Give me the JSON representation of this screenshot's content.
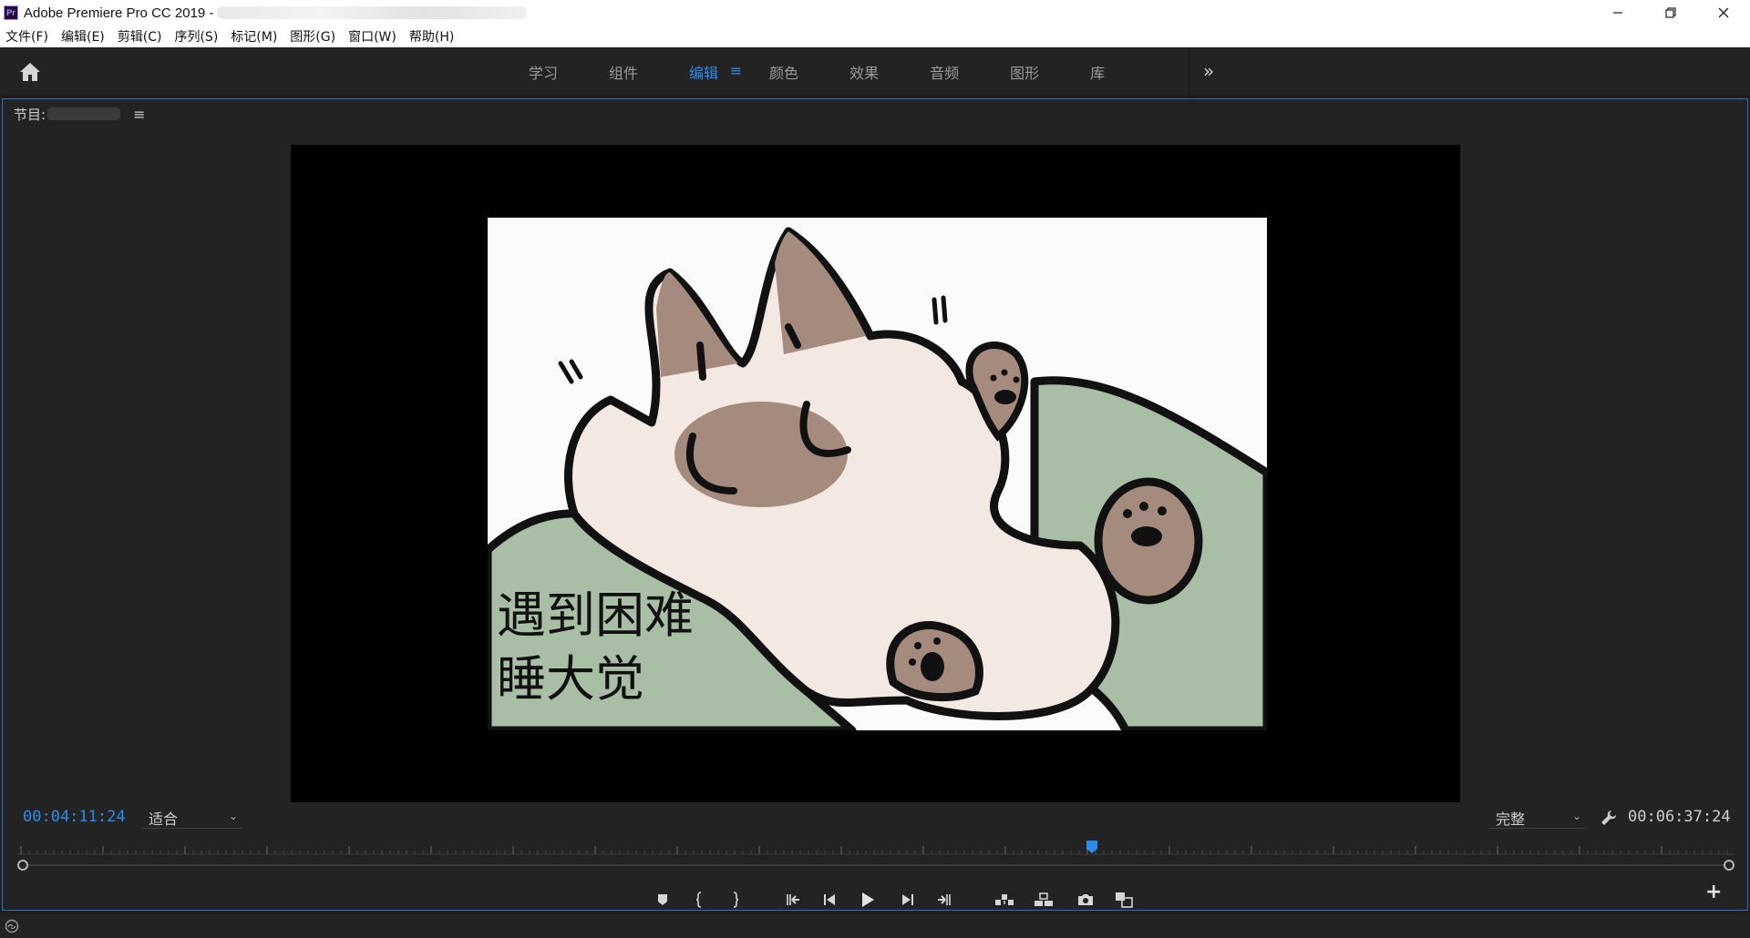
{
  "window": {
    "title": "Adobe Premiere Pro CC 2019 -",
    "app_logo": "Pr",
    "controls": [
      "minimize-icon",
      "restore-icon",
      "close-icon"
    ]
  },
  "menu": [
    "文件(F)",
    "编辑(E)",
    "剪辑(C)",
    "序列(S)",
    "标记(M)",
    "图形(G)",
    "窗口(W)",
    "帮助(H)"
  ],
  "workspaces": {
    "tabs": [
      "学习",
      "组件",
      "编辑",
      "颜色",
      "效果",
      "音频",
      "图形",
      "库"
    ],
    "active": "编辑",
    "overflow": "»"
  },
  "program_monitor": {
    "panel_label": "节目:",
    "frame_caption_line1": "遇到困难",
    "frame_caption_line2": "睡大觉",
    "timecode_current": "00:04:11:24",
    "zoom_select": "适合",
    "quality_select": "完整",
    "timecode_duration": "00:06:37:24",
    "playhead_fraction": 0.626
  },
  "transport_buttons": [
    "add-marker-icon",
    "mark-in-icon",
    "mark-out-icon",
    "go-to-in-icon",
    "step-back-icon",
    "play-icon",
    "step-forward-icon",
    "go-to-out-icon",
    "lift-icon",
    "extract-icon",
    "export-frame-icon",
    "comparison-view-icon"
  ],
  "colors": {
    "accent": "#2d8ceb",
    "panel_bg": "#232323",
    "hill": "#a8bfa6",
    "cat_body": "#f3e9e2",
    "cat_brown": "#a58a7e"
  }
}
